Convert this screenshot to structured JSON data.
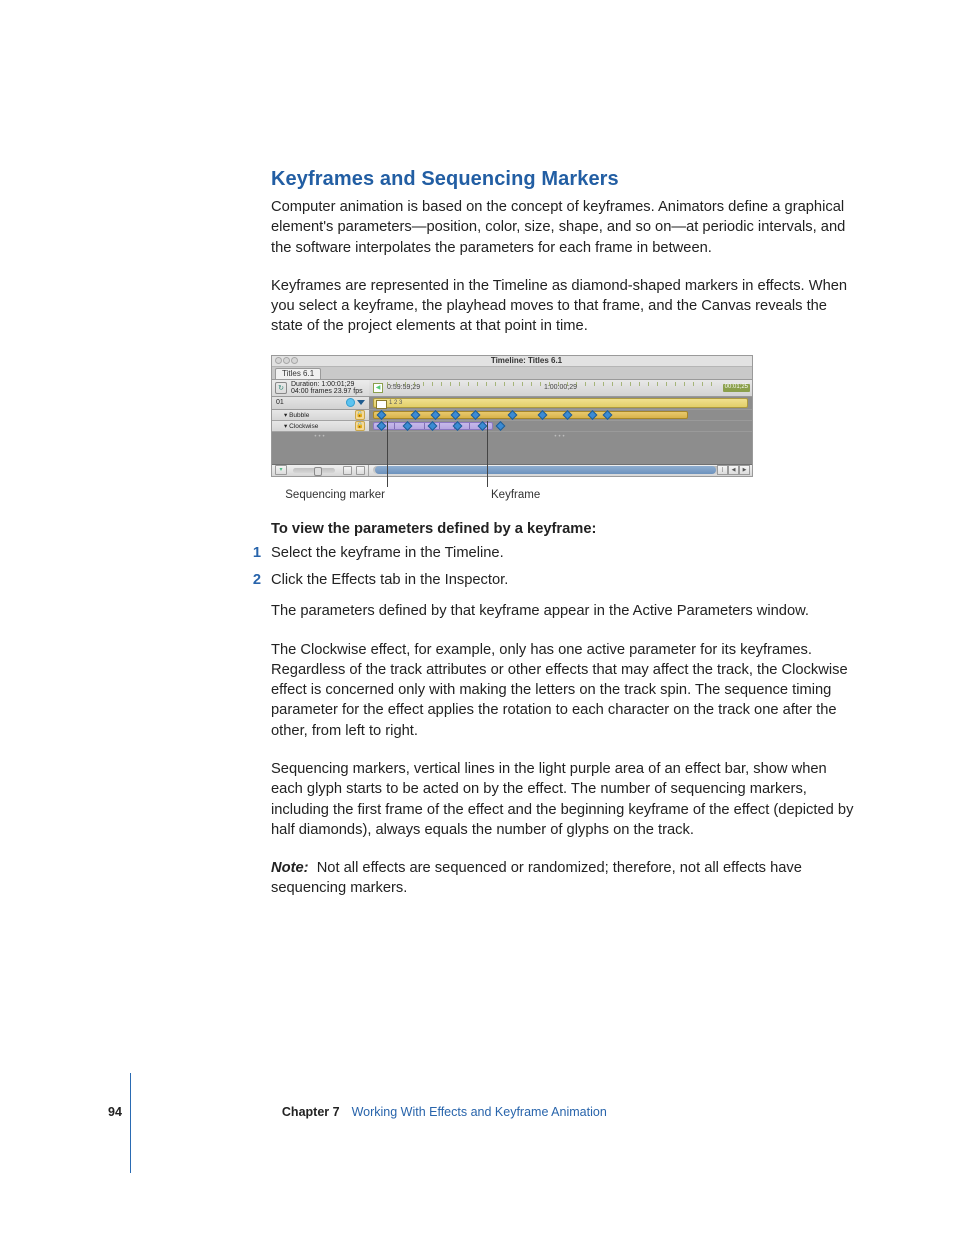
{
  "section": {
    "title": "Keyframes and Sequencing Markers",
    "para1": "Computer animation is based on the concept of keyframes. Animators define a graphical element's parameters—position, color, size, shape, and so on—at periodic intervals, and the software interpolates the parameters for each frame in between.",
    "para2": "Keyframes are represented in the Timeline as diamond-shaped markers in effects. When you select a keyframe, the playhead moves to that frame, and the Canvas reveals the state of the project elements at that point in time."
  },
  "figure": {
    "windowTitle": "Timeline: Titles 6.1",
    "tab": "Titles 6.1",
    "durationLabel": "Duration: 1:00:01;29",
    "fpsLabel": "04:00 frames 23.97 fps",
    "rulerStart": "0:59:59;29",
    "rulerMid": "1:00:00;29",
    "rulerEnd": "00:01;25",
    "trackName": "01",
    "trackLabel": "1 2 3",
    "subBubble": "Bubble",
    "subClockwise": "Clockwise",
    "callout_seq": "Sequencing marker",
    "callout_kf": "Keyframe"
  },
  "proc": {
    "heading": "To view the parameters defined by a keyframe:",
    "step1_num": "1",
    "step1": "Select the keyframe in the Timeline.",
    "step2_num": "2",
    "step2": "Click the Effects tab in the Inspector.",
    "afterSteps": "The parameters defined by that keyframe appear in the Active Parameters window.",
    "para3": "The Clockwise effect, for example, only has one active parameter for its keyframes. Regardless of the track attributes or other effects that may affect the track, the Clockwise effect is concerned only with making the letters on the track spin. The sequence timing parameter for the effect applies the rotation to each character on the track one after the other, from left to right.",
    "para4": "Sequencing markers, vertical lines in the light purple area of an effect bar, show when each glyph starts to be acted on by the effect. The number of sequencing markers, including the first frame of the effect and the beginning keyframe of the effect (depicted by half diamonds), always equals the number of glyphs on the track.",
    "noteLabel": "Note:",
    "noteBody": "Not all effects are sequenced or randomized; therefore, not all effects have sequencing markers."
  },
  "footer": {
    "page": "94",
    "chapterLabel": "Chapter 7",
    "chapterTitle": "Working With Effects and Keyframe Animation"
  }
}
